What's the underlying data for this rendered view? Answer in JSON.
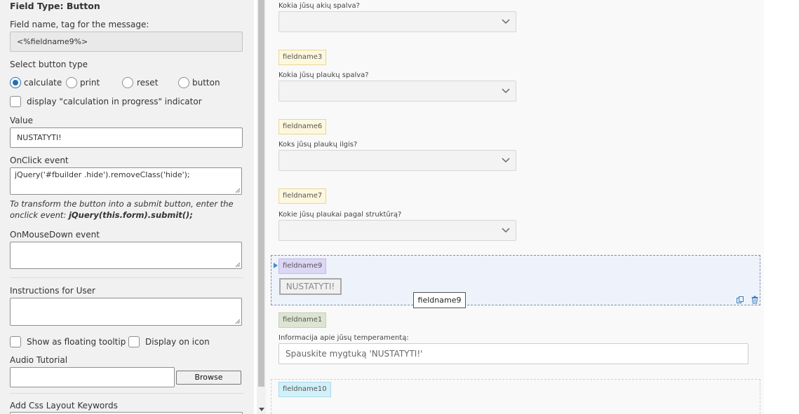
{
  "settings": {
    "title": "Field Type: Button",
    "field_name_label": "Field name, tag for the message:",
    "field_name_value": "<%fieldname9%>",
    "button_type_label": "Select button type",
    "button_types": [
      "calculate",
      "print",
      "reset",
      "button"
    ],
    "selected_button_type": "calculate",
    "calc_indicator_label": "display \"calculation in progress\" indicator",
    "value_label": "Value",
    "value": "NUSTATYTI!",
    "onclick_label": "OnClick event",
    "onclick_value": "jQuery('#fbuilder .hide').removeClass('hide');",
    "hint_text": "To transform the button into a submit button, enter the onclick event:",
    "hint_code": "jQuery(this.form).submit();",
    "onmousedown_label": "OnMouseDown event",
    "onmousedown_value": "",
    "instructions_label": "Instructions for User",
    "instructions_value": "",
    "floating_tooltip_label": "Show as floating tooltip",
    "display_icon_label": "Display on icon",
    "audio_tutorial_label": "Audio Tutorial",
    "audio_tutorial_value": "",
    "browse_label": "Browse",
    "css_keywords_label": "Add Css Layout Keywords"
  },
  "form": {
    "q_eye_color": "Kokia jūsų akių spalva?",
    "tag_3": "fieldname3",
    "q_hair_color": "Kokia jūsų plaukų spalva?",
    "tag_6": "fieldname6",
    "q_hair_length": "Koks jūsų plaukų ilgis?",
    "tag_7": "fieldname7",
    "q_hair_structure": "Kokie jūsų plaukai pagal struktūrą?",
    "tag_9": "fieldname9",
    "button_value": "NUSTATYTI!",
    "tooltip": "fieldname9",
    "tag_1": "fieldname1",
    "temperament_label": "Informacija apie jūsų temperamentą:",
    "temperament_value": "Spauskite mygtuką 'NUSTATYTI!'",
    "tag_10": "fieldname10"
  },
  "colors": {
    "accent": "#2271b1",
    "selected_tag": "#ddd6f5",
    "default_tag": "#fdf7dd",
    "text_tag": "#dde5d2",
    "html_tag": "#d2f0f8"
  },
  "icons": {
    "select_arrow": "chevron-down-icon",
    "duplicate": "copy-icon",
    "delete": "trash-icon",
    "selected_marker": "triangle-right-icon"
  }
}
